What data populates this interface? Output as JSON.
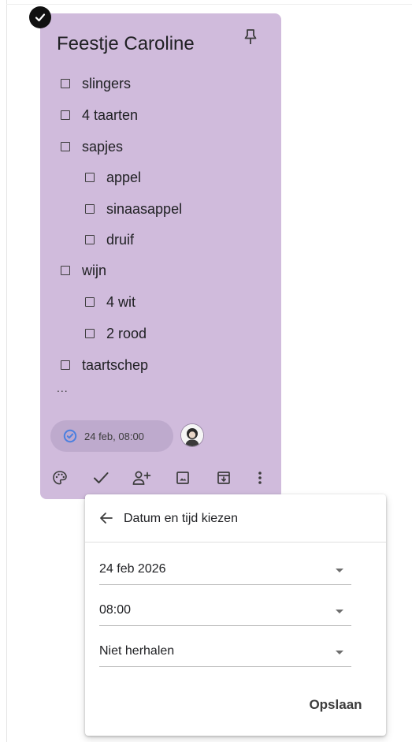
{
  "note": {
    "title": "Feestje Caroline",
    "items": [
      {
        "label": "slingers",
        "level": 0
      },
      {
        "label": "4 taarten",
        "level": 0
      },
      {
        "label": "sapjes",
        "level": 0
      },
      {
        "label": "appel",
        "level": 1
      },
      {
        "label": "sinaasappel",
        "level": 1
      },
      {
        "label": "druif",
        "level": 1
      },
      {
        "label": "wijn",
        "level": 0
      },
      {
        "label": "4 wit",
        "level": 1
      },
      {
        "label": "2 rood",
        "level": 1
      },
      {
        "label": "taartschep",
        "level": 0
      }
    ],
    "overflow_indicator": "...",
    "reminder": "24 feb, 08:00",
    "background_color": "#d0bbdc",
    "toolbar_icons": [
      "palette-icon",
      "checkmark-icon",
      "add-collaborator-icon",
      "image-icon",
      "archive-icon",
      "more-vert-icon"
    ]
  },
  "popup": {
    "title": "Datum en tijd kiezen",
    "date": "24 feb 2026",
    "time": "08:00",
    "repeat": "Niet herhalen",
    "save_label": "Opslaan"
  }
}
